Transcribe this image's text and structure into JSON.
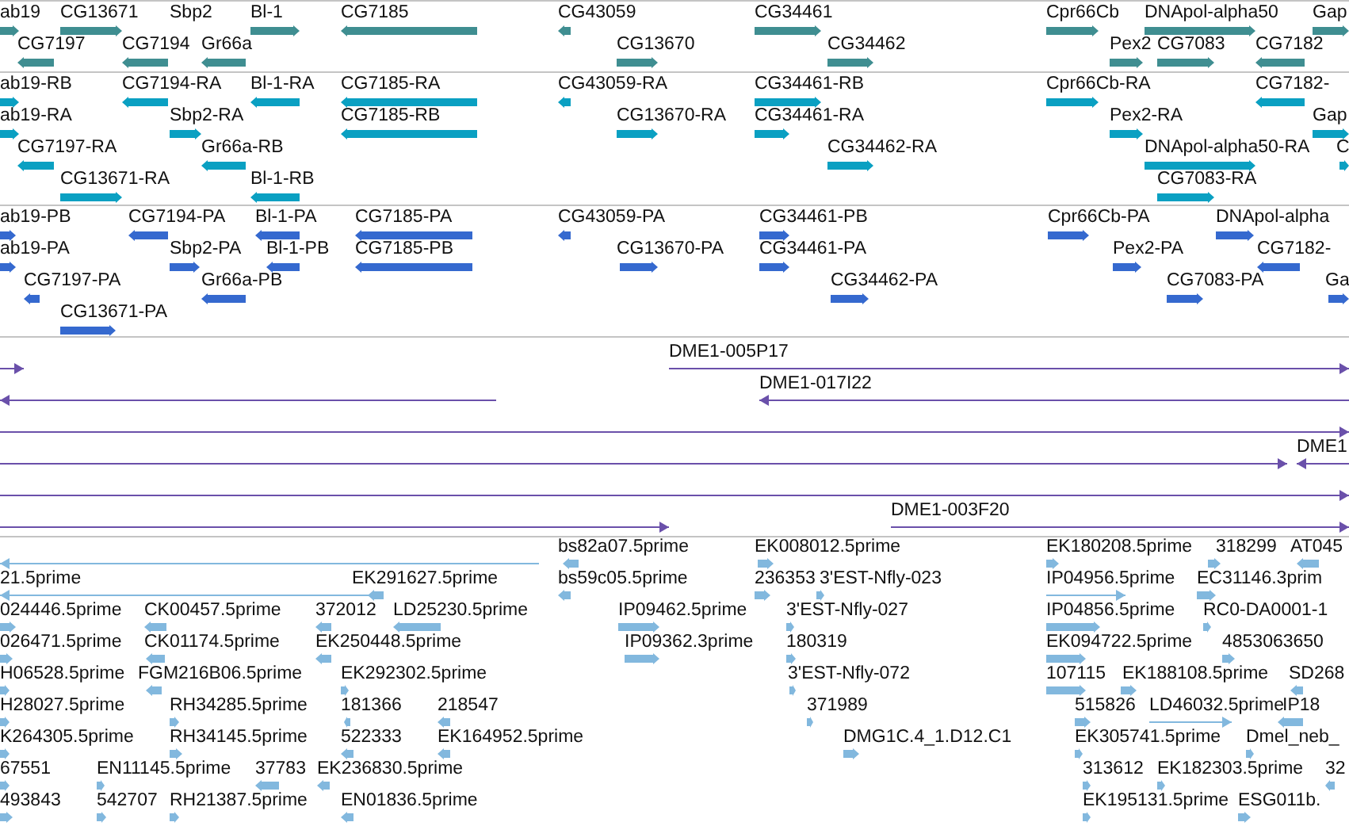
{
  "tracks": [
    {
      "kind": "gene",
      "lanes": [
        {
          "features": [
            {
              "label": "ab19",
              "forward": true
            },
            {
              "label": "CG13671",
              "forward": true
            },
            {
              "label": "Sbp2"
            },
            {
              "label": "Bl-1",
              "forward": true
            },
            {
              "label": "CG7185",
              "forward": false
            },
            {
              "label": "CG43059",
              "forward": false
            },
            {
              "label": "CG34461",
              "forward": true
            },
            {
              "label": "Cpr66Cb",
              "forward": true
            },
            {
              "label": "DNApol-alpha50",
              "forward": true
            },
            {
              "label": "Gap",
              "forward": true
            }
          ]
        },
        {
          "features": [
            {
              "label": "CG7197",
              "forward": false
            },
            {
              "label": "CG7194",
              "forward": false
            },
            {
              "label": "Gr66a",
              "forward": false
            },
            {
              "label": "CG13670",
              "forward": true
            },
            {
              "label": "CG34462",
              "forward": true
            },
            {
              "label": "Pex2",
              "forward": true
            },
            {
              "label": "CG7083",
              "forward": true
            },
            {
              "label": "CG7182",
              "forward": false
            }
          ]
        }
      ]
    },
    {
      "kind": "transcript",
      "lanes": [
        {
          "features": [
            {
              "label": "ab19-RB",
              "forward": true
            },
            {
              "label": "CG7194-RA",
              "forward": false
            },
            {
              "label": "Bl-1-RA",
              "forward": false
            },
            {
              "label": "CG7185-RA",
              "forward": false
            },
            {
              "label": "CG43059-RA",
              "forward": false
            },
            {
              "label": "CG34461-RB",
              "forward": true
            },
            {
              "label": "Cpr66Cb-RA",
              "forward": true
            },
            {
              "label": "CG7182-",
              "forward": false
            }
          ]
        },
        {
          "features": [
            {
              "label": "ab19-RA",
              "forward": true
            },
            {
              "label": "Sbp2-RA",
              "forward": true
            },
            {
              "label": "CG7185-RB",
              "forward": false
            },
            {
              "label": "CG13670-RA",
              "forward": true
            },
            {
              "label": "CG34461-RA",
              "forward": true
            },
            {
              "label": "Pex2-RA",
              "forward": true
            },
            {
              "label": "Gap",
              "forward": true
            }
          ]
        },
        {
          "features": [
            {
              "label": "CG7197-RA",
              "forward": false
            },
            {
              "label": "Gr66a-RB",
              "forward": false
            },
            {
              "label": "CG34462-RA",
              "forward": true
            },
            {
              "label": "DNApol-alpha50-RA",
              "forward": true
            },
            {
              "label": "C",
              "forward": true
            }
          ]
        },
        {
          "features": [
            {
              "label": "CG13671-RA",
              "forward": true
            },
            {
              "label": "Bl-1-RB",
              "forward": false
            },
            {
              "label": "CG7083-RA",
              "forward": true
            }
          ]
        }
      ]
    },
    {
      "kind": "protein",
      "lanes": [
        {
          "features": [
            {
              "label": "ab19-PB",
              "forward": true
            },
            {
              "label": "CG7194-PA",
              "forward": false
            },
            {
              "label": "Bl-1-PA",
              "forward": false
            },
            {
              "label": "CG7185-PA",
              "forward": false
            },
            {
              "label": "CG43059-PA",
              "forward": false
            },
            {
              "label": "CG34461-PB",
              "forward": true
            },
            {
              "label": "Cpr66Cb-PA",
              "forward": true
            },
            {
              "label": "DNApol-alpha",
              "forward": true
            }
          ]
        },
        {
          "features": [
            {
              "label": "ab19-PA",
              "forward": true
            },
            {
              "label": "Sbp2-PA",
              "forward": true
            },
            {
              "label": "Bl-1-PB",
              "forward": false
            },
            {
              "label": "CG7185-PB",
              "forward": false
            },
            {
              "label": "CG13670-PA",
              "forward": true
            },
            {
              "label": "CG34461-PA",
              "forward": true
            },
            {
              "label": "Pex2-PA",
              "forward": true
            },
            {
              "label": "CG7182-",
              "forward": false
            }
          ]
        },
        {
          "features": [
            {
              "label": "CG7197-PA",
              "forward": false
            },
            {
              "label": "Gr66a-PB",
              "forward": false
            },
            {
              "label": "CG34462-PA",
              "forward": true
            },
            {
              "label": "CG7083-PA",
              "forward": true
            },
            {
              "label": "Ga",
              "forward": true
            }
          ]
        },
        {
          "features": [
            {
              "label": "CG13671-PA",
              "forward": true
            }
          ]
        }
      ]
    },
    {
      "kind": "clone",
      "lanes": [
        {
          "features": [
            {
              "forward": true
            },
            {
              "label": "DME1-005P17",
              "forward": true
            }
          ]
        },
        {
          "features": [
            {
              "forward": false
            },
            {
              "label": "DME1-017I22",
              "forward": false
            }
          ]
        },
        {
          "features": [
            {
              "forward": true
            }
          ]
        },
        {
          "features": [
            {
              "forward": true
            },
            {
              "label": "DME1",
              "forward": false
            }
          ]
        },
        {
          "features": [
            {
              "forward": true
            }
          ]
        },
        {
          "features": [
            {
              "forward": true
            },
            {
              "label": "DME1-003F20",
              "forward": true
            }
          ]
        }
      ]
    },
    {
      "kind": "est",
      "lanes": [
        {
          "features": [
            {
              "forward": false
            },
            {
              "label": "bs82a07.5prime",
              "forward": false
            },
            {
              "label": "EK008012.5prime",
              "forward": true
            },
            {
              "label": "EK180208.5prime",
              "forward": true
            },
            {
              "label": "318299",
              "forward": true
            },
            {
              "label": "AT045",
              "forward": false
            }
          ]
        },
        {
          "features": [
            {
              "label": "21.5prime",
              "forward": false
            },
            {
              "label": "EK291627.5prime",
              "forward": false
            },
            {
              "label": "bs59c05.5prime",
              "forward": false
            },
            {
              "label": "236353",
              "forward": true
            },
            {
              "label": "3'EST-Nfly-023",
              "forward": true
            },
            {
              "label": "IP04956.5prime",
              "forward": true
            },
            {
              "label": "EC31146.3prim",
              "forward": true
            }
          ]
        },
        {
          "features": [
            {
              "label": "024446.5prime",
              "forward": true
            },
            {
              "label": "CK00457.5prime",
              "forward": false
            },
            {
              "label": "372012",
              "forward": false
            },
            {
              "label": "LD25230.5prime",
              "forward": false
            },
            {
              "label": "IP09462.5prime",
              "forward": true
            },
            {
              "label": "3'EST-Nfly-027",
              "forward": true
            },
            {
              "label": "IP04856.5prime",
              "forward": true
            },
            {
              "label": "RC0-DA0001-1",
              "forward": true
            }
          ]
        },
        {
          "features": [
            {
              "label": "026471.5prime",
              "forward": true
            },
            {
              "label": "CK01174.5prime",
              "forward": false
            },
            {
              "label": "EK250448.5prime",
              "forward": false
            },
            {
              "label": "IP09362.3prime",
              "forward": true
            },
            {
              "label": "180319",
              "forward": true
            },
            {
              "label": "EK094722.5prime",
              "forward": true
            },
            {
              "label": "4853063650",
              "forward": true
            }
          ]
        },
        {
          "features": [
            {
              "label": "H06528.5prime",
              "forward": true
            },
            {
              "label": "FGM216B06.5prime",
              "forward": false
            },
            {
              "label": "EK292302.5prime",
              "forward": true
            },
            {
              "label": "3'EST-Nfly-072",
              "forward": true
            },
            {
              "label": "107115",
              "forward": true
            },
            {
              "label": "EK188108.5prime",
              "forward": true
            },
            {
              "label": "SD268",
              "forward": false
            }
          ]
        },
        {
          "features": [
            {
              "label": "H28027.5prime",
              "forward": true
            },
            {
              "label": "RH34285.5prime",
              "forward": true
            },
            {
              "label": "181366",
              "forward": false
            },
            {
              "label": "218547",
              "forward": false
            },
            {
              "label": "371989",
              "forward": true
            },
            {
              "label": "515826",
              "forward": true
            },
            {
              "label": "LD46032.5prime",
              "forward": true
            },
            {
              "label": "IP18",
              "forward": false
            }
          ]
        },
        {
          "features": [
            {
              "label": "K264305.5prime",
              "forward": true
            },
            {
              "label": "RH34145.5prime",
              "forward": true
            },
            {
              "label": "522333",
              "forward": false
            },
            {
              "label": "EK164952.5prime",
              "forward": false
            },
            {
              "label": "DMG1C.4_1.D12.C1",
              "forward": true
            },
            {
              "label": "EK305741.5prime",
              "forward": true
            },
            {
              "label": "Dmel_neb_",
              "forward": true
            }
          ]
        },
        {
          "features": [
            {
              "label": "67551",
              "forward": true
            },
            {
              "label": "EN11145.5prime",
              "forward": true
            },
            {
              "label": "37783",
              "forward": false
            },
            {
              "label": "EK236830.5prime",
              "forward": false
            },
            {
              "label": "313612",
              "forward": true
            },
            {
              "label": "EK182303.5prime",
              "forward": true
            },
            {
              "label": "32",
              "forward": false
            }
          ]
        },
        {
          "features": [
            {
              "label": "493843",
              "forward": true
            },
            {
              "label": "542707",
              "forward": true
            },
            {
              "label": "RH21387.5prime",
              "forward": true
            },
            {
              "label": "EN01836.5prime",
              "forward": false
            },
            {
              "label": "EK195131.5prime",
              "forward": true
            },
            {
              "label": "ESG011b.",
              "forward": true
            }
          ]
        }
      ]
    }
  ]
}
